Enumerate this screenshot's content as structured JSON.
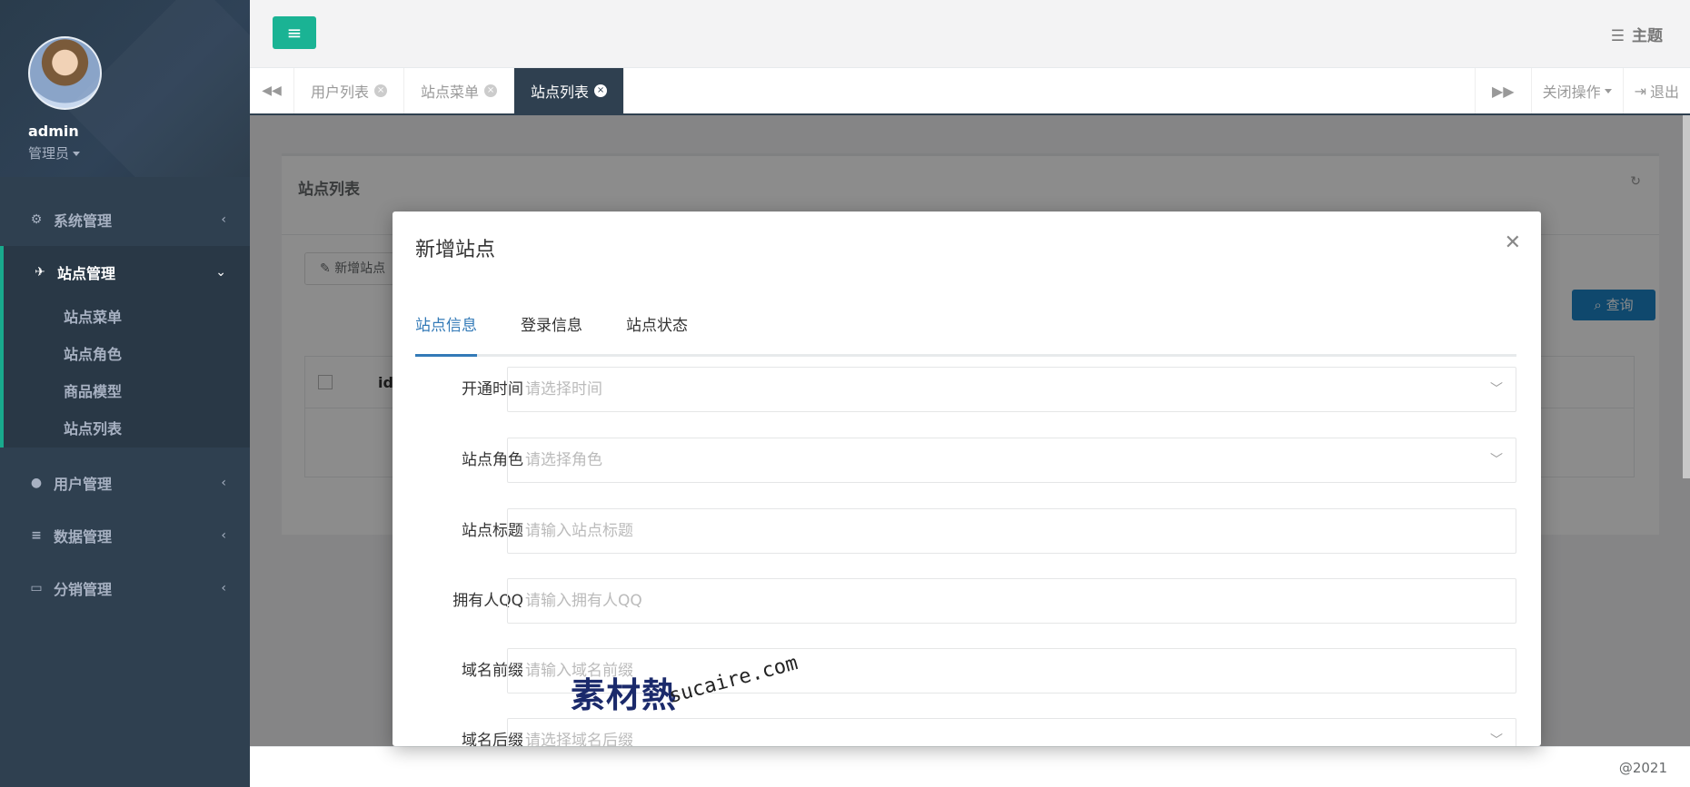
{
  "sidebar": {
    "user": {
      "name": "admin",
      "role": "管理员"
    },
    "menu": [
      {
        "label": "系统管理",
        "icon": "gears-icon"
      },
      {
        "label": "站点管理",
        "icon": "paper-plane-icon",
        "active": true,
        "children": [
          "站点菜单",
          "站点角色",
          "商品模型",
          "站点列表"
        ]
      },
      {
        "label": "用户管理",
        "icon": "user-icon"
      },
      {
        "label": "数据管理",
        "icon": "database-icon"
      },
      {
        "label": "分销管理",
        "icon": "desktop-icon"
      }
    ]
  },
  "topbar": {
    "theme_label": "主题",
    "theme_icon": "theme-icon"
  },
  "tabs": {
    "items": [
      "用户列表",
      "站点菜单",
      "站点列表"
    ],
    "active": "站点列表",
    "close_ops": "关闭操作",
    "logout": "退出"
  },
  "panel": {
    "title": "站点列表",
    "add_button": "新增站点",
    "query_button": "查询",
    "table_header_id": "id"
  },
  "modal": {
    "title": "新增站点",
    "tabs": [
      "站点信息",
      "登录信息",
      "站点状态"
    ],
    "active_tab": "站点信息",
    "fields": [
      {
        "label": "开通时间",
        "placeholder": "请选择时间",
        "type": "select"
      },
      {
        "label": "站点角色",
        "placeholder": "请选择角色",
        "type": "select"
      },
      {
        "label": "站点标题",
        "placeholder": "请输入站点标题",
        "type": "input"
      },
      {
        "label": "拥有人QQ",
        "placeholder": "请输入拥有人QQ",
        "type": "input"
      },
      {
        "label": "域名前缀",
        "placeholder": "请输入域名前缀",
        "type": "input"
      },
      {
        "label": "域名后缀",
        "placeholder": "请选择域名后缀",
        "type": "select"
      }
    ]
  },
  "footer": {
    "copyright": "@2021"
  },
  "watermark": {
    "main": "素材熱",
    "sub": "sucaire.com"
  },
  "colors": {
    "sidebar": "#2f4050",
    "accent": "#1ab394",
    "primary": "#1c84c6",
    "tab_active": "#337ab7"
  }
}
